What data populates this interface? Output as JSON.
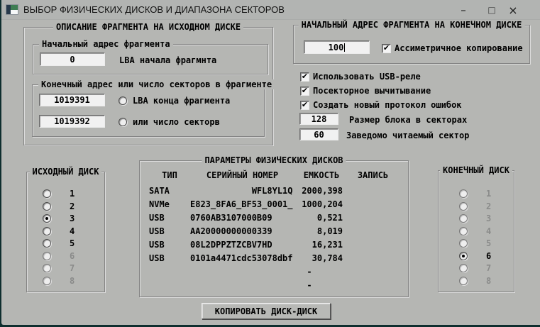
{
  "window": {
    "title": "ВЫБОР ФИЗИЧЕСКИХ ДИСКОВ И ДИАПАЗОНА СЕКТОРОВ",
    "minimize_glyph": "–",
    "maximize_glyph": "□",
    "close_glyph": "×"
  },
  "source_fragment": {
    "title": "ОПИСАНИЕ ФРАГМЕНТА НА ИСХОДНОМ ДИСКЕ",
    "start": {
      "title": "Начальный адрес фрагмента",
      "value": "0",
      "label": "LBA начала фрагмнта"
    },
    "end": {
      "title": "Конечный адрес или число секторов в фрагменте",
      "end_value": "1019391",
      "end_radio_label": "LBA конца фрагмента",
      "end_radio_selected": false,
      "count_value": "1019392",
      "count_radio_label": "или число секторв",
      "count_radio_selected": false
    }
  },
  "dest_fragment": {
    "title": "НАЧАЛЬНЫЙ АДРЕС ФРАГМЕНТА НА КОНЕЧНОМ ДИСКЕ",
    "value": "100",
    "asymmetric_label": "Ассиметричное копирование",
    "asymmetric_checked": true
  },
  "options": {
    "usb_relay": {
      "label": "Использовать USB-реле",
      "checked": true
    },
    "sector_read": {
      "label": "Посекторное вычитывание",
      "checked": true
    },
    "new_log": {
      "label": "Создать новый протокол ошибок",
      "checked": true
    },
    "block_size": {
      "value": "128",
      "label": "Размер блока в секторах"
    },
    "known_sector": {
      "value": "60",
      "label": "Заведомо читаемый сектор"
    }
  },
  "disk_table": {
    "title": "ПАРАМЕТРЫ ФИЗИЧЕСКИХ ДИСКОВ",
    "headers": {
      "type": "ТИП",
      "serial": "СЕРИЙНЫЙ НОМЕР",
      "capacity": "ЕМКОСТЬ",
      "write": "ЗАПИСЬ"
    },
    "rows": [
      {
        "type": "SATA",
        "serial": "            WFL8YL1Q",
        "capacity": "2000,398",
        "write": ""
      },
      {
        "type": "NVMe",
        "serial": "E823_8FA6_BF53_0001_",
        "capacity": "1000,204",
        "write": ""
      },
      {
        "type": "USB",
        "serial": "0760AB3107000B09",
        "capacity": "0,521",
        "write": ""
      },
      {
        "type": "USB",
        "serial": "AA20000000000339",
        "capacity": "8,019",
        "write": ""
      },
      {
        "type": "USB",
        "serial": "08L2DPPZTZCBV7HD",
        "capacity": "16,231",
        "write": ""
      },
      {
        "type": "USB",
        "serial": "0101a4471cdc53078dbf",
        "capacity": "30,784",
        "write": ""
      },
      {
        "type": "",
        "serial": "",
        "capacity": "-      ",
        "write": ""
      },
      {
        "type": "",
        "serial": "",
        "capacity": "-      ",
        "write": ""
      }
    ]
  },
  "source_disk": {
    "title": "ИСХОДНЫЙ ДИСК",
    "options": [
      {
        "label": "1",
        "selected": false,
        "disabled": false
      },
      {
        "label": "2",
        "selected": false,
        "disabled": false
      },
      {
        "label": "3",
        "selected": true,
        "disabled": false
      },
      {
        "label": "4",
        "selected": false,
        "disabled": false
      },
      {
        "label": "5",
        "selected": false,
        "disabled": false
      },
      {
        "label": "6",
        "selected": false,
        "disabled": true
      },
      {
        "label": "7",
        "selected": false,
        "disabled": true
      },
      {
        "label": "8",
        "selected": false,
        "disabled": true
      }
    ]
  },
  "dest_disk": {
    "title": "КОНЕЧНЫЙ ДИСК",
    "options": [
      {
        "label": "1",
        "selected": false,
        "disabled": true
      },
      {
        "label": "2",
        "selected": false,
        "disabled": true
      },
      {
        "label": "3",
        "selected": false,
        "disabled": true
      },
      {
        "label": "4",
        "selected": false,
        "disabled": true
      },
      {
        "label": "5",
        "selected": false,
        "disabled": true
      },
      {
        "label": "6",
        "selected": true,
        "disabled": false
      },
      {
        "label": "7",
        "selected": false,
        "disabled": true
      },
      {
        "label": "8",
        "selected": false,
        "disabled": true
      }
    ]
  },
  "footer": {
    "copy_button": "КОПИРОВАТЬ ДИСК-ДИСК"
  },
  "colors": {
    "desktop": "#0e2e2e",
    "window_bg": "#b5b6b3",
    "field_bg": "#f1f1f1",
    "text": "#000000",
    "disabled_text": "#8a8b8a",
    "icon_dark": "#27394a",
    "icon_green": "#3e7d52"
  }
}
